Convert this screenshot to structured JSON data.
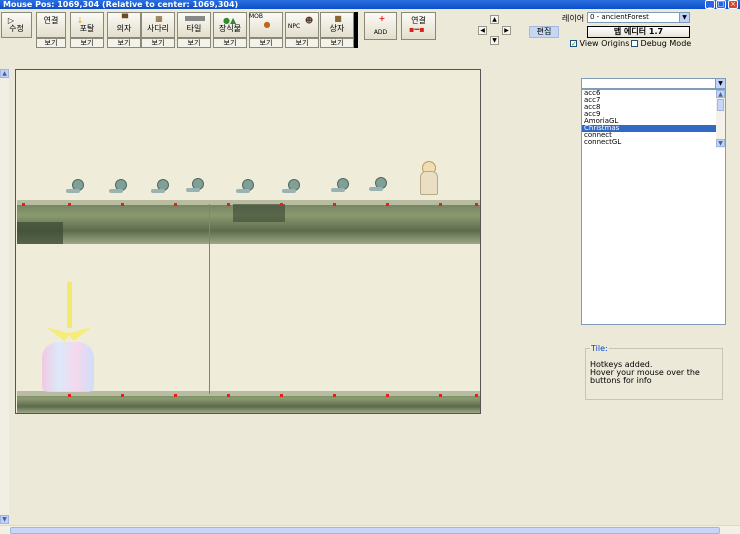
{
  "window": {
    "title": "Mouse Pos: 1069,304 (Relative to center: 1069,304)"
  },
  "toolbar": {
    "tools": [
      {
        "label": "수정",
        "icon": "cursor-icon"
      },
      {
        "label": "연결",
        "icon": "connect-icon"
      },
      {
        "label": "포탈",
        "icon": "portal-icon"
      },
      {
        "label": "의자",
        "icon": "chair-icon"
      },
      {
        "label": "사다리",
        "icon": "ladder-icon"
      },
      {
        "label": "타일",
        "icon": "tile-icon"
      },
      {
        "label": "장식물",
        "icon": "decoration-icon"
      },
      {
        "label": "MOB",
        "icon": "mob-icon"
      },
      {
        "label": "NPC",
        "icon": "npc-icon"
      },
      {
        "label": "상자",
        "icon": "box-icon"
      }
    ],
    "view_label": "보기",
    "add_button": "ADD",
    "connect_button": "연결",
    "edit_button": "편집"
  },
  "layer": {
    "label": "레이어",
    "value": "0 - ancientForest"
  },
  "version_button": "맵 에디터 1.7",
  "checkboxes": {
    "view_origins": {
      "label": "View Origins",
      "checked": true
    },
    "debug_mode": {
      "label": "Debug Mode",
      "checked": false
    }
  },
  "object_list": {
    "items": [
      "acc6",
      "acc7",
      "acc8",
      "acc9",
      "AmoriaGL",
      "Christmas",
      "connect",
      "connectGL"
    ],
    "selected": "Christmas"
  },
  "info": {
    "title": "Tile:",
    "text": "Hotkeys added.\n Hover your mouse over the buttons for info"
  }
}
